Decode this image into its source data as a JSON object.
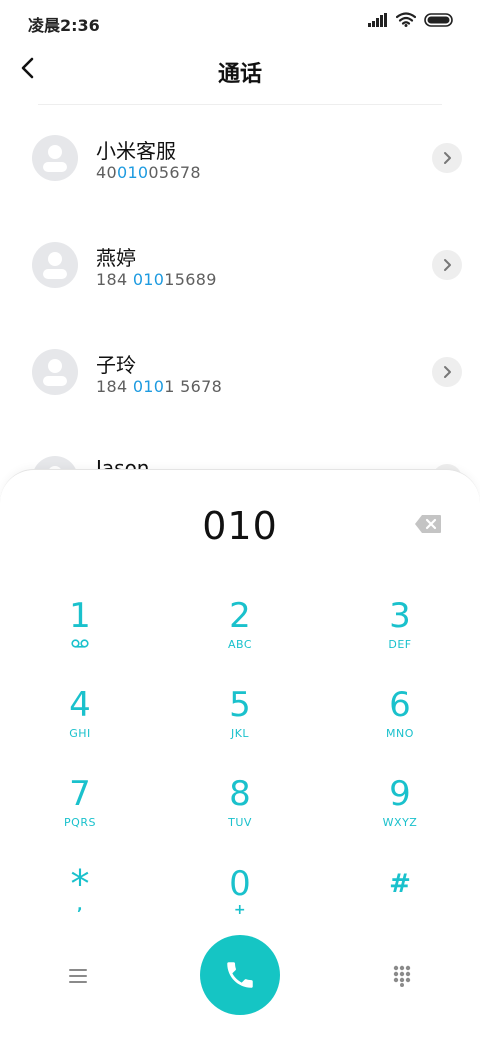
{
  "status_bar": {
    "time": "凌晨2:36"
  },
  "header": {
    "title": "通话"
  },
  "contacts": [
    {
      "name": "小米客服",
      "number_pre": "40",
      "number_match": "010",
      "number_post": "05678"
    },
    {
      "name": "燕婷",
      "number_pre": "184 ",
      "number_match": "010",
      "number_post": "15689"
    },
    {
      "name": "子玲",
      "number_pre": "184 ",
      "number_match": "010",
      "number_post": "1 5678"
    },
    {
      "name": "Jason",
      "number_pre": "",
      "number_match": "",
      "number_post": ""
    }
  ],
  "dialpad": {
    "input": "010",
    "keys": [
      {
        "digit": "1",
        "letters": ""
      },
      {
        "digit": "2",
        "letters": "ABC"
      },
      {
        "digit": "3",
        "letters": "DEF"
      },
      {
        "digit": "4",
        "letters": "GHI"
      },
      {
        "digit": "5",
        "letters": "JKL"
      },
      {
        "digit": "6",
        "letters": "MNO"
      },
      {
        "digit": "7",
        "letters": "PQRS"
      },
      {
        "digit": "8",
        "letters": "TUV"
      },
      {
        "digit": "9",
        "letters": "WXYZ"
      },
      {
        "digit": "*",
        "letters": ","
      },
      {
        "digit": "0",
        "letters": "+"
      },
      {
        "digit": "#",
        "letters": ""
      }
    ]
  },
  "icons": {
    "back": "chevron-left-icon",
    "detail": "chevron-right-icon",
    "delete": "backspace-icon",
    "voicemail": "voicemail-icon",
    "menu": "menu-icon",
    "call": "phone-icon",
    "keypad": "dialpad-icon"
  },
  "colors": {
    "accent": "#1ac1cc",
    "call_button": "#15c5c4",
    "match_highlight": "#1e9be0"
  }
}
